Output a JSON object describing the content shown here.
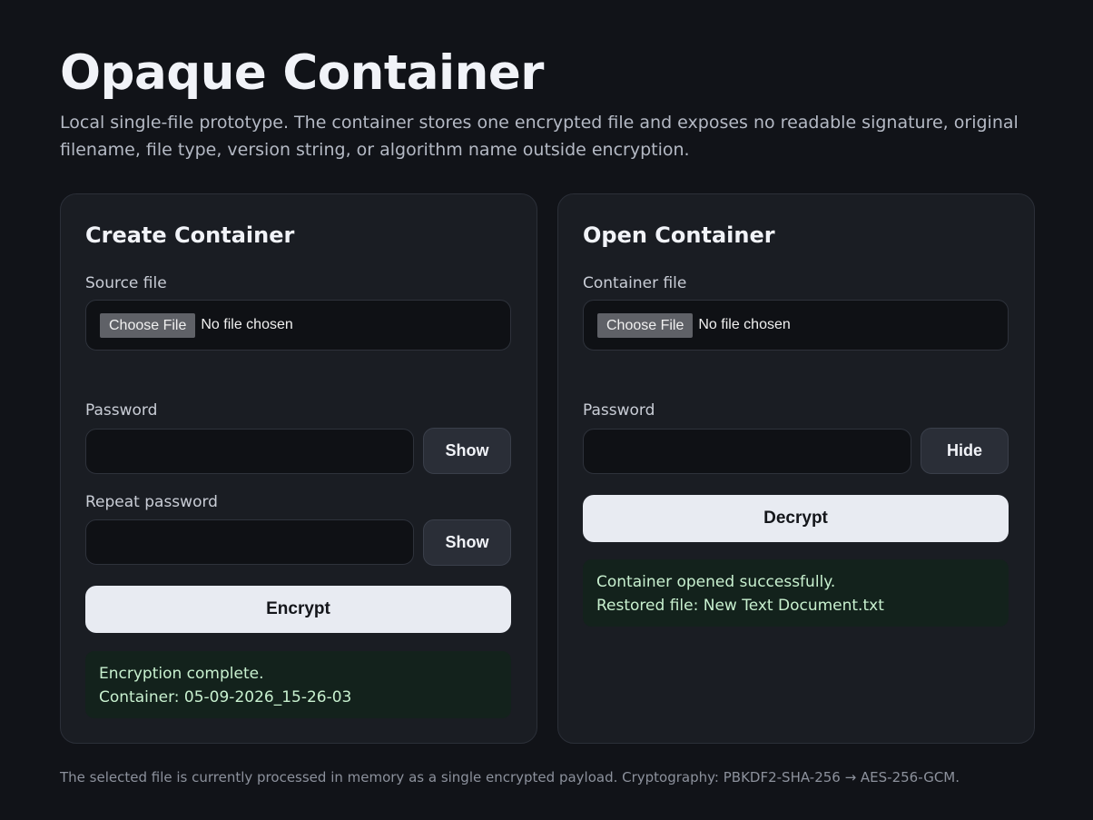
{
  "header": {
    "title": "Opaque Container",
    "subtitle": "Local single-file prototype. The container stores one encrypted file and exposes no readable signature, original filename, file type, version string, or algorithm name outside encryption."
  },
  "create": {
    "title": "Create Container",
    "source_label": "Source file",
    "file_button": "Choose File",
    "file_status": "No file chosen",
    "password_label": "Password",
    "password_toggle": "Show",
    "repeat_label": "Repeat password",
    "repeat_toggle": "Show",
    "action": "Encrypt",
    "status_line1": "Encryption complete.",
    "status_line2": "Container: 05-09-2026_15-26-03"
  },
  "open": {
    "title": "Open Container",
    "container_label": "Container file",
    "file_button": "Choose File",
    "file_status": "No file chosen",
    "password_label": "Password",
    "password_toggle": "Hide",
    "action": "Decrypt",
    "status_line1": "Container opened successfully.",
    "status_line2": "Restored file: New Text Document.txt"
  },
  "footer": {
    "text": "The selected file is currently processed in memory as a single encrypted payload. Cryptography: PBKDF2-SHA-256 → AES-256-GCM."
  }
}
